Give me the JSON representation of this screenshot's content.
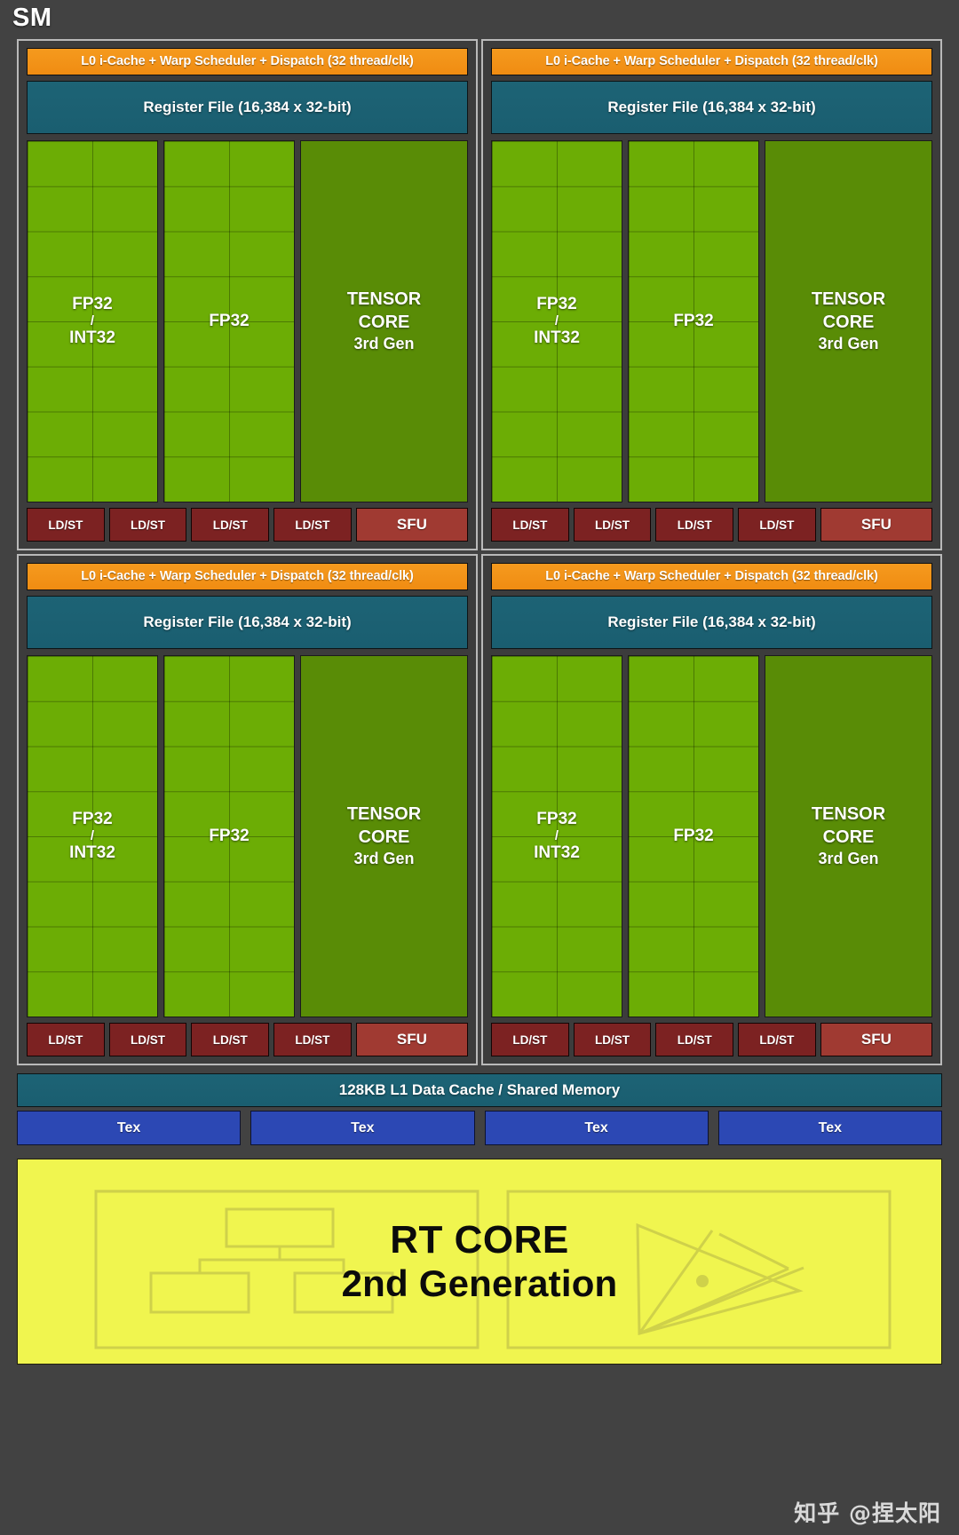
{
  "title": "SM",
  "partitions": [
    {
      "scheduler": "L0 i-Cache + Warp Scheduler + Dispatch (32 thread/clk)",
      "register_file": "Register File (16,384 x 32-bit)",
      "fp_columns": [
        {
          "line1": "FP32",
          "slash": "/",
          "line2": "INT32"
        },
        {
          "line1": "FP32",
          "slash": "",
          "line2": ""
        }
      ],
      "tensor": {
        "line1": "TENSOR",
        "line2": "CORE",
        "line3": "3rd Gen"
      },
      "ldst": [
        "LD/ST",
        "LD/ST",
        "LD/ST",
        "LD/ST"
      ],
      "sfu": "SFU"
    },
    {
      "scheduler": "L0 i-Cache + Warp Scheduler + Dispatch (32 thread/clk)",
      "register_file": "Register File (16,384 x 32-bit)",
      "fp_columns": [
        {
          "line1": "FP32",
          "slash": "/",
          "line2": "INT32"
        },
        {
          "line1": "FP32",
          "slash": "",
          "line2": ""
        }
      ],
      "tensor": {
        "line1": "TENSOR",
        "line2": "CORE",
        "line3": "3rd Gen"
      },
      "ldst": [
        "LD/ST",
        "LD/ST",
        "LD/ST",
        "LD/ST"
      ],
      "sfu": "SFU"
    },
    {
      "scheduler": "L0 i-Cache + Warp Scheduler + Dispatch (32 thread/clk)",
      "register_file": "Register File (16,384 x 32-bit)",
      "fp_columns": [
        {
          "line1": "FP32",
          "slash": "/",
          "line2": "INT32"
        },
        {
          "line1": "FP32",
          "slash": "",
          "line2": ""
        }
      ],
      "tensor": {
        "line1": "TENSOR",
        "line2": "CORE",
        "line3": "3rd Gen"
      },
      "ldst": [
        "LD/ST",
        "LD/ST",
        "LD/ST",
        "LD/ST"
      ],
      "sfu": "SFU"
    },
    {
      "scheduler": "L0 i-Cache + Warp Scheduler + Dispatch (32 thread/clk)",
      "register_file": "Register File (16,384 x 32-bit)",
      "fp_columns": [
        {
          "line1": "FP32",
          "slash": "/",
          "line2": "INT32"
        },
        {
          "line1": "FP32",
          "slash": "",
          "line2": ""
        }
      ],
      "tensor": {
        "line1": "TENSOR",
        "line2": "CORE",
        "line3": "3rd Gen"
      },
      "ldst": [
        "LD/ST",
        "LD/ST",
        "LD/ST",
        "LD/ST"
      ],
      "sfu": "SFU"
    }
  ],
  "l1_cache": "128KB L1 Data Cache / Shared Memory",
  "tex_units": [
    "Tex",
    "Tex",
    "Tex",
    "Tex"
  ],
  "rt_core": {
    "line1": "RT CORE",
    "line2": "2nd Generation"
  },
  "watermark": "知乎 @捏太阳",
  "colors": {
    "background": "#424242",
    "scheduler_orange": "#f08c12",
    "register_teal": "#1a5e70",
    "fp32_green": "#6cad05",
    "tensor_green": "#598c06",
    "ldst_red": "#7c2222",
    "sfu_red": "#a03a32",
    "tex_blue": "#2c48b4",
    "rt_yellow": "#f0f54f",
    "partition_border": "#b9b9b9"
  }
}
